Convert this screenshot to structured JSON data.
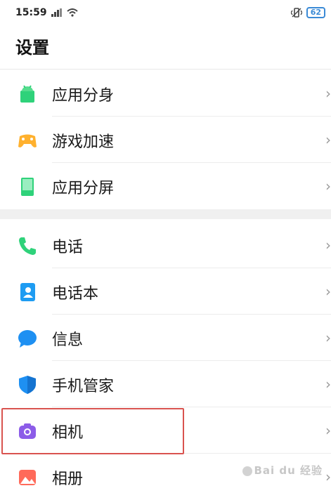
{
  "status_bar": {
    "time": "15:59",
    "battery": "62"
  },
  "title": "设置",
  "groups": [
    {
      "items": [
        {
          "label": "应用分身",
          "icon": "android-icon"
        },
        {
          "label": "游戏加速",
          "icon": "gamepad-icon"
        },
        {
          "label": "应用分屏",
          "icon": "split-screen-icon"
        }
      ]
    },
    {
      "items": [
        {
          "label": "电话",
          "icon": "phone-icon"
        },
        {
          "label": "电话本",
          "icon": "contacts-icon"
        },
        {
          "label": "信息",
          "icon": "message-icon"
        },
        {
          "label": "手机管家",
          "icon": "shield-icon"
        },
        {
          "label": "相机",
          "icon": "camera-icon"
        },
        {
          "label": "相册",
          "icon": "gallery-icon"
        }
      ]
    }
  ],
  "chevron": "›",
  "watermark": "Bai du 经验",
  "colors": {
    "highlight": "#d9534f",
    "green": "#2fd27a",
    "blue": "#1e90f2",
    "purple": "#8c5ce8"
  }
}
